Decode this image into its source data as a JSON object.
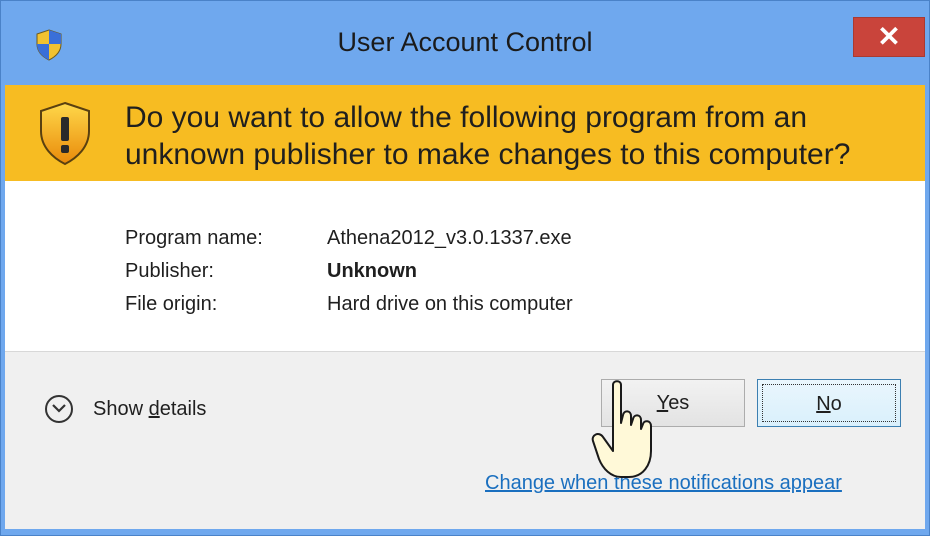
{
  "window": {
    "title": "User Account Control",
    "close_glyph": "✕"
  },
  "question": "Do you want to allow the following program from an unknown publisher to make changes to this computer?",
  "details": {
    "program_name": {
      "label": "Program name:",
      "value": "Athena2012_v3.0.1337.exe"
    },
    "publisher": {
      "label": "Publisher:",
      "value": "Unknown"
    },
    "file_origin": {
      "label": "File origin:",
      "value": "Hard drive on this computer"
    }
  },
  "footer": {
    "show_details_prefix": "Show ",
    "show_details_accel": "d",
    "show_details_suffix": "etails",
    "yes_accel": "Y",
    "yes_rest": "es",
    "no_accel": "N",
    "no_rest": "o",
    "change_link": "Change when these notifications appear"
  },
  "icons": {
    "title": "uac-shield-icon",
    "warning": "warning-shield-icon",
    "expand": "chevron-down-icon",
    "cursor": "hand-pointer-cursor"
  },
  "colors": {
    "titlebar": "#6fa8ee",
    "banner": "#f7bc22",
    "close": "#c9443b",
    "link": "#1a6fbf"
  }
}
